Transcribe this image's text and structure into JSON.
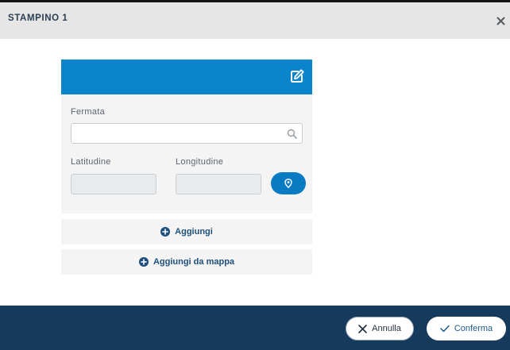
{
  "dialog": {
    "title": "STAMPINO 1"
  },
  "card": {
    "edit_icon": "edit-icon",
    "stop_label": "Fermata",
    "search_value": "",
    "search_placeholder": "",
    "latitude_label": "Latitudine",
    "latitude_value": "",
    "longitude_label": "Longitudine",
    "longitude_value": "",
    "header_color": "#0a85cc"
  },
  "actions": {
    "add_label": "Aggiungi",
    "add_from_map_label": "Aggiungi da mappa"
  },
  "footer": {
    "cancel_label": "Annulla",
    "confirm_label": "Conferma",
    "background": "#163a5c"
  }
}
